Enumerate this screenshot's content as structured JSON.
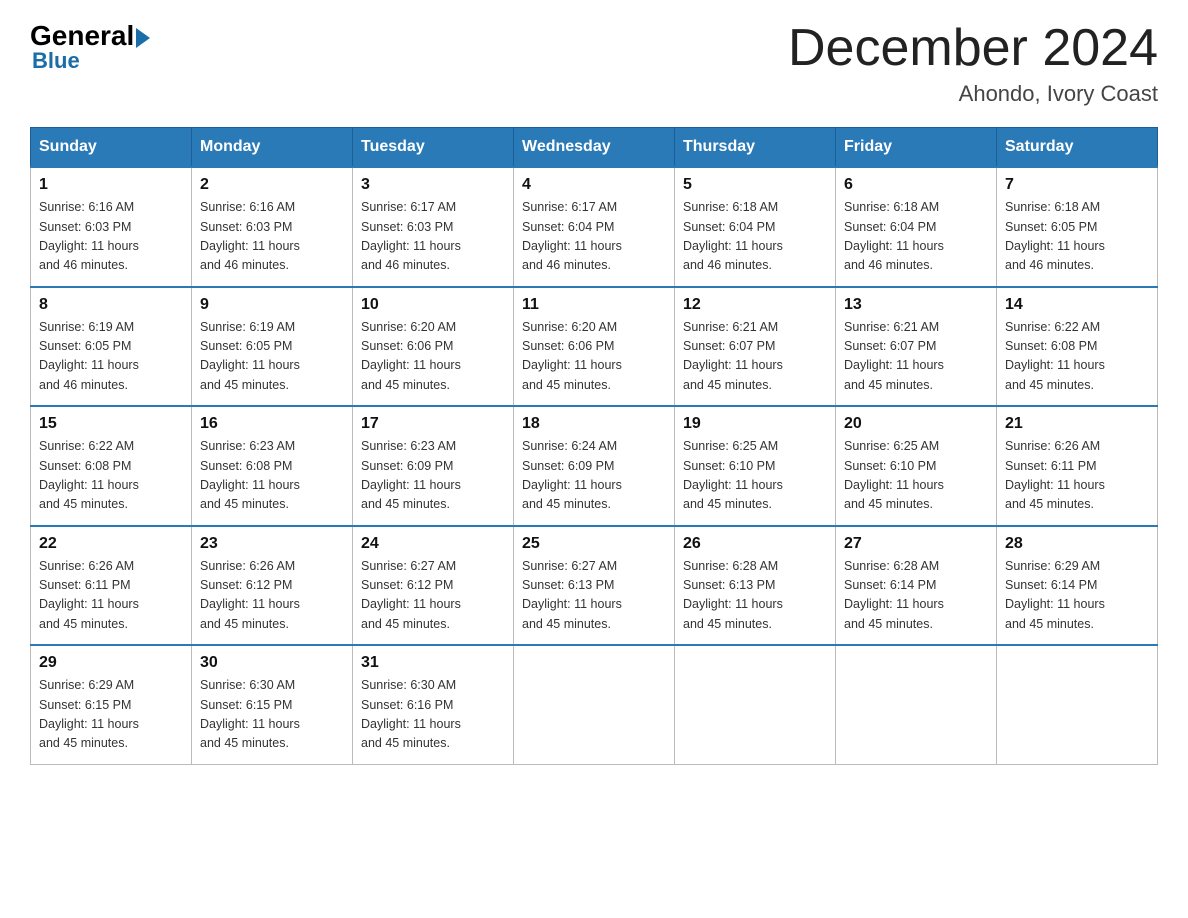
{
  "header": {
    "logo_text_general": "General",
    "logo_text_blue": "Blue",
    "month_year": "December 2024",
    "location": "Ahondo, Ivory Coast"
  },
  "days_of_week": [
    "Sunday",
    "Monday",
    "Tuesday",
    "Wednesday",
    "Thursday",
    "Friday",
    "Saturday"
  ],
  "weeks": [
    [
      {
        "day": "1",
        "sunrise": "6:16 AM",
        "sunset": "6:03 PM",
        "daylight": "11 hours and 46 minutes."
      },
      {
        "day": "2",
        "sunrise": "6:16 AM",
        "sunset": "6:03 PM",
        "daylight": "11 hours and 46 minutes."
      },
      {
        "day": "3",
        "sunrise": "6:17 AM",
        "sunset": "6:03 PM",
        "daylight": "11 hours and 46 minutes."
      },
      {
        "day": "4",
        "sunrise": "6:17 AM",
        "sunset": "6:04 PM",
        "daylight": "11 hours and 46 minutes."
      },
      {
        "day": "5",
        "sunrise": "6:18 AM",
        "sunset": "6:04 PM",
        "daylight": "11 hours and 46 minutes."
      },
      {
        "day": "6",
        "sunrise": "6:18 AM",
        "sunset": "6:04 PM",
        "daylight": "11 hours and 46 minutes."
      },
      {
        "day": "7",
        "sunrise": "6:18 AM",
        "sunset": "6:05 PM",
        "daylight": "11 hours and 46 minutes."
      }
    ],
    [
      {
        "day": "8",
        "sunrise": "6:19 AM",
        "sunset": "6:05 PM",
        "daylight": "11 hours and 46 minutes."
      },
      {
        "day": "9",
        "sunrise": "6:19 AM",
        "sunset": "6:05 PM",
        "daylight": "11 hours and 45 minutes."
      },
      {
        "day": "10",
        "sunrise": "6:20 AM",
        "sunset": "6:06 PM",
        "daylight": "11 hours and 45 minutes."
      },
      {
        "day": "11",
        "sunrise": "6:20 AM",
        "sunset": "6:06 PM",
        "daylight": "11 hours and 45 minutes."
      },
      {
        "day": "12",
        "sunrise": "6:21 AM",
        "sunset": "6:07 PM",
        "daylight": "11 hours and 45 minutes."
      },
      {
        "day": "13",
        "sunrise": "6:21 AM",
        "sunset": "6:07 PM",
        "daylight": "11 hours and 45 minutes."
      },
      {
        "day": "14",
        "sunrise": "6:22 AM",
        "sunset": "6:08 PM",
        "daylight": "11 hours and 45 minutes."
      }
    ],
    [
      {
        "day": "15",
        "sunrise": "6:22 AM",
        "sunset": "6:08 PM",
        "daylight": "11 hours and 45 minutes."
      },
      {
        "day": "16",
        "sunrise": "6:23 AM",
        "sunset": "6:08 PM",
        "daylight": "11 hours and 45 minutes."
      },
      {
        "day": "17",
        "sunrise": "6:23 AM",
        "sunset": "6:09 PM",
        "daylight": "11 hours and 45 minutes."
      },
      {
        "day": "18",
        "sunrise": "6:24 AM",
        "sunset": "6:09 PM",
        "daylight": "11 hours and 45 minutes."
      },
      {
        "day": "19",
        "sunrise": "6:25 AM",
        "sunset": "6:10 PM",
        "daylight": "11 hours and 45 minutes."
      },
      {
        "day": "20",
        "sunrise": "6:25 AM",
        "sunset": "6:10 PM",
        "daylight": "11 hours and 45 minutes."
      },
      {
        "day": "21",
        "sunrise": "6:26 AM",
        "sunset": "6:11 PM",
        "daylight": "11 hours and 45 minutes."
      }
    ],
    [
      {
        "day": "22",
        "sunrise": "6:26 AM",
        "sunset": "6:11 PM",
        "daylight": "11 hours and 45 minutes."
      },
      {
        "day": "23",
        "sunrise": "6:26 AM",
        "sunset": "6:12 PM",
        "daylight": "11 hours and 45 minutes."
      },
      {
        "day": "24",
        "sunrise": "6:27 AM",
        "sunset": "6:12 PM",
        "daylight": "11 hours and 45 minutes."
      },
      {
        "day": "25",
        "sunrise": "6:27 AM",
        "sunset": "6:13 PM",
        "daylight": "11 hours and 45 minutes."
      },
      {
        "day": "26",
        "sunrise": "6:28 AM",
        "sunset": "6:13 PM",
        "daylight": "11 hours and 45 minutes."
      },
      {
        "day": "27",
        "sunrise": "6:28 AM",
        "sunset": "6:14 PM",
        "daylight": "11 hours and 45 minutes."
      },
      {
        "day": "28",
        "sunrise": "6:29 AM",
        "sunset": "6:14 PM",
        "daylight": "11 hours and 45 minutes."
      }
    ],
    [
      {
        "day": "29",
        "sunrise": "6:29 AM",
        "sunset": "6:15 PM",
        "daylight": "11 hours and 45 minutes."
      },
      {
        "day": "30",
        "sunrise": "6:30 AM",
        "sunset": "6:15 PM",
        "daylight": "11 hours and 45 minutes."
      },
      {
        "day": "31",
        "sunrise": "6:30 AM",
        "sunset": "6:16 PM",
        "daylight": "11 hours and 45 minutes."
      },
      null,
      null,
      null,
      null
    ]
  ],
  "labels": {
    "sunrise": "Sunrise:",
    "sunset": "Sunset:",
    "daylight": "Daylight:"
  }
}
